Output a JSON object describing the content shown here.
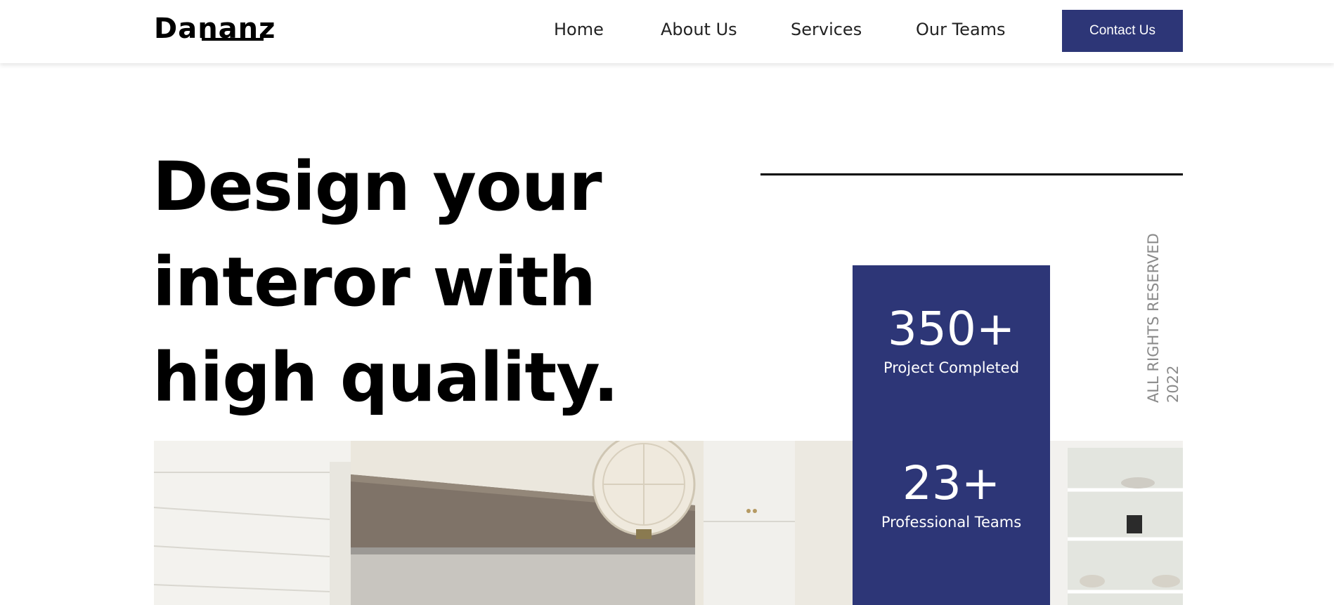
{
  "nav": {
    "logo": "Dananz",
    "links": [
      "Home",
      "About Us",
      "Services",
      "Our Teams"
    ],
    "cta": "Contact Us"
  },
  "hero": {
    "title": "Design your interor with high quality."
  },
  "stats": [
    {
      "number": "350+",
      "label": "Project Completed"
    },
    {
      "number": "23+",
      "label": "Professional Teams"
    }
  ],
  "rights": {
    "year": "2022",
    "text": "ALL RIGHTS RESERVED"
  },
  "colors": {
    "brand": "#2d3677",
    "text": "#000000",
    "muted": "#8a8a8a"
  }
}
